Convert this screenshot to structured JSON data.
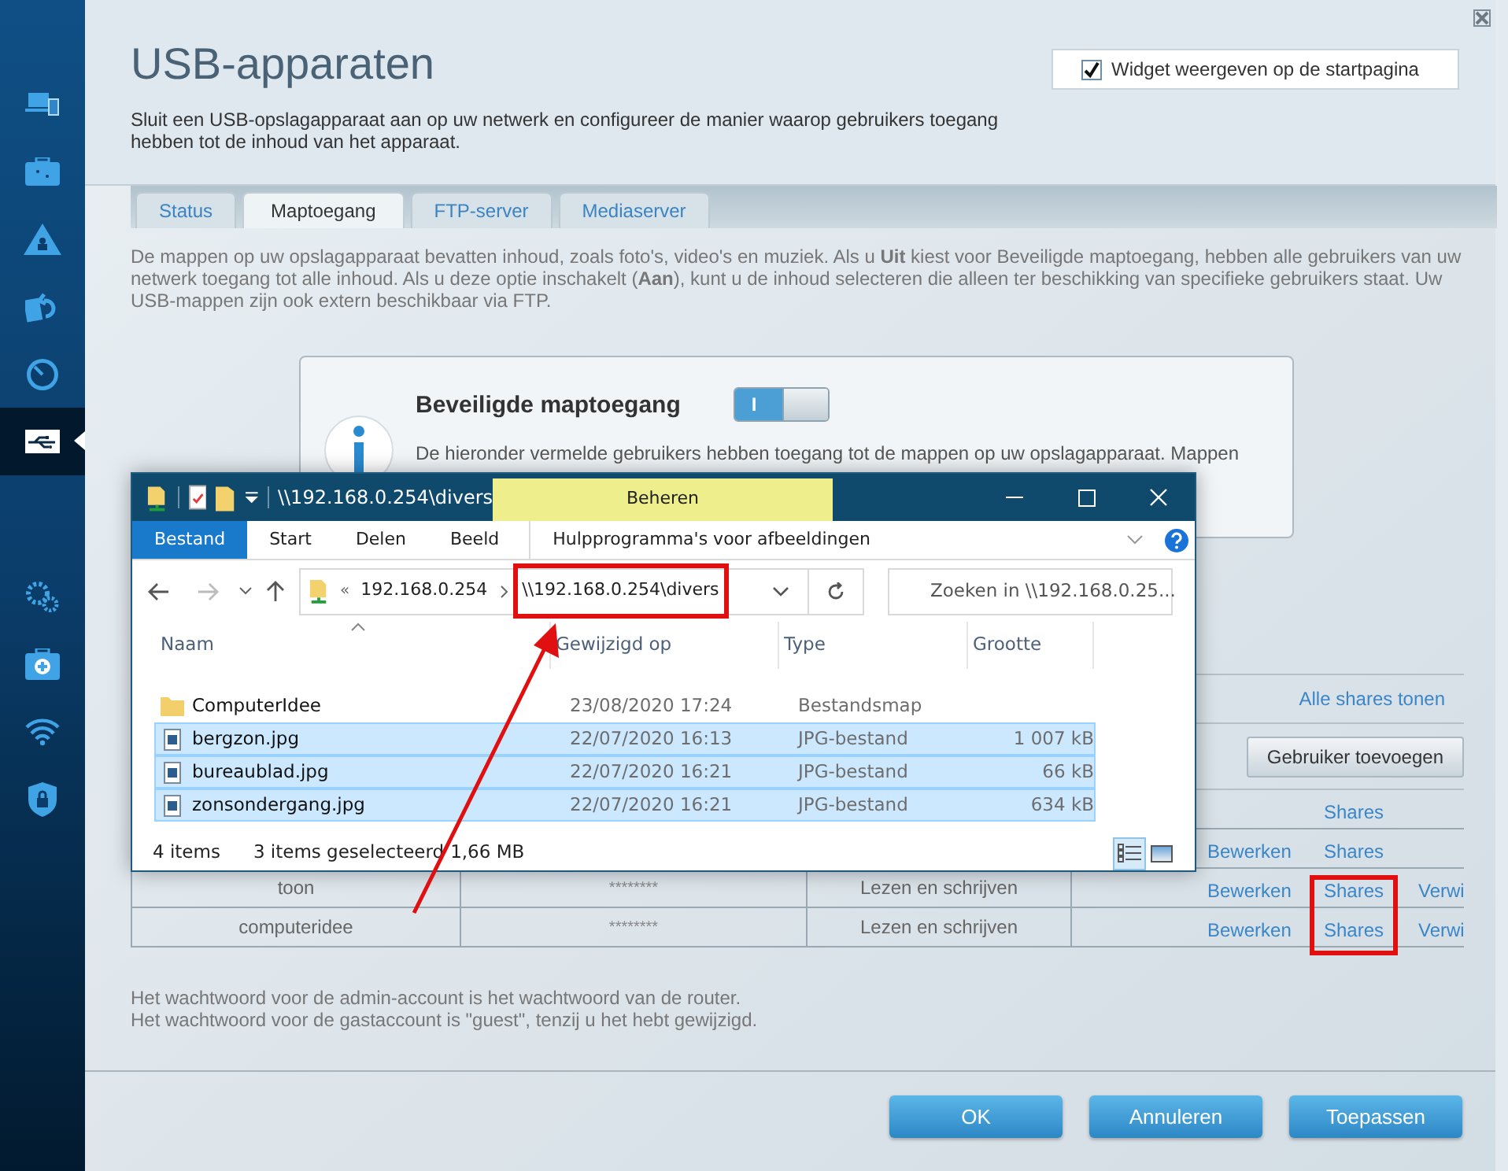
{
  "sidebar": {
    "items": [
      {
        "selected": false
      },
      {
        "selected": false
      },
      {
        "selected": false
      },
      {
        "selected": false
      },
      {
        "selected": false
      },
      {
        "selected": true
      },
      {
        "selected": false
      },
      {
        "selected": false
      },
      {
        "selected": false
      },
      {
        "selected": false
      }
    ]
  },
  "page": {
    "title": "USB-apparaten",
    "description": "Sluit een USB-opslagapparaat aan op uw netwerk en configureer de manier waarop gebruikers toegang hebben tot de inhoud van het apparaat.",
    "widget_checkbox": {
      "label": "Widget weergeven op de startpagina",
      "checked": true
    }
  },
  "tabs": [
    {
      "label": "Status",
      "selected": false
    },
    {
      "label": "Maptoegang",
      "selected": true
    },
    {
      "label": "FTP-server",
      "selected": false
    },
    {
      "label": "Mediaserver",
      "selected": false
    }
  ],
  "intro": "De mappen op uw opslagapparaat bevatten inhoud, zoals foto's, video's en muziek. Als u **Uit** kiest voor Beveiligde maptoegang, hebben alle gebruikers van uw netwerk toegang tot alle inhoud. Als u deze optie inschakelt (**Aan**), kunt u de inhoud selecteren die alleen ter beschikking van specifieke gebruikers staat. Uw USB-mappen zijn ook extern beschikbaar via FTP.",
  "secure_access": {
    "title": "Beveiligde maptoegang",
    "toggle_label": "I",
    "on": true,
    "text": "De hieronder vermelde gebruikers hebben toegang tot de mappen op uw opslagapparaat. Mappen"
  },
  "users": {
    "all_shares_link": "Alle shares tonen",
    "add_button": "Gebruiker toevoegen",
    "rows": [
      {
        "shares": "Shares"
      },
      {
        "edit": "Bewerken",
        "shares": "Shares"
      },
      {
        "user": "toon",
        "password": "********",
        "access": "Lezen en schrijven",
        "edit": "Bewerken",
        "shares": "Shares",
        "delete": "Verwi"
      },
      {
        "user": "computeridee",
        "password": "********",
        "access": "Lezen en schrijven",
        "edit": "Bewerken",
        "shares": "Shares",
        "delete": "Verwi"
      }
    ]
  },
  "notes": [
    "Het wachtwoord voor de admin-account is het wachtwoord van de router.",
    "Het wachtwoord voor de gastaccount is \"guest\", tenzij u het hebt gewijzigd."
  ],
  "buttons": [
    "OK",
    "Annuleren",
    "Toepassen"
  ],
  "explorer": {
    "title": "\\\\192.168.0.254\\divers",
    "context_tab": "Beheren",
    "ribbon_tabs": [
      {
        "label": "Bestand",
        "selected": true
      },
      {
        "label": "Start",
        "selected": false
      },
      {
        "label": "Delen",
        "selected": false
      },
      {
        "label": "Beeld",
        "selected": false
      },
      {
        "label": "Hulpprogramma's voor afbeeldingen",
        "selected": false
      }
    ],
    "address": {
      "overflow": "«",
      "crumb": "192.168.0.254",
      "current": "\\\\192.168.0.254\\divers"
    },
    "search": {
      "placeholder": "Zoeken in \\\\192.168.0.25..."
    },
    "columns": [
      "Naam",
      "Gewijzigd op",
      "Type",
      "Grootte"
    ],
    "files": [
      {
        "kind": "folder",
        "name": "ComputerIdee",
        "modified": "23/08/2020 17:24",
        "type": "Bestandsmap",
        "selected": false
      },
      {
        "kind": "image",
        "name": "bergzon.jpg",
        "modified": "22/07/2020 16:13",
        "type": "JPG-bestand",
        "size": "1 007 kB",
        "selected": true
      },
      {
        "kind": "image",
        "name": "bureaublad.jpg",
        "modified": "22/07/2020 16:21",
        "type": "JPG-bestand",
        "size": "66 kB",
        "selected": true
      },
      {
        "kind": "image",
        "name": "zonsondergang.jpg",
        "modified": "22/07/2020 16:21",
        "type": "JPG-bestand",
        "size": "634 kB",
        "selected": true
      }
    ],
    "status": {
      "count": "4 items",
      "selection": "3 items geselecteerd",
      "size": "1,66 MB"
    }
  }
}
